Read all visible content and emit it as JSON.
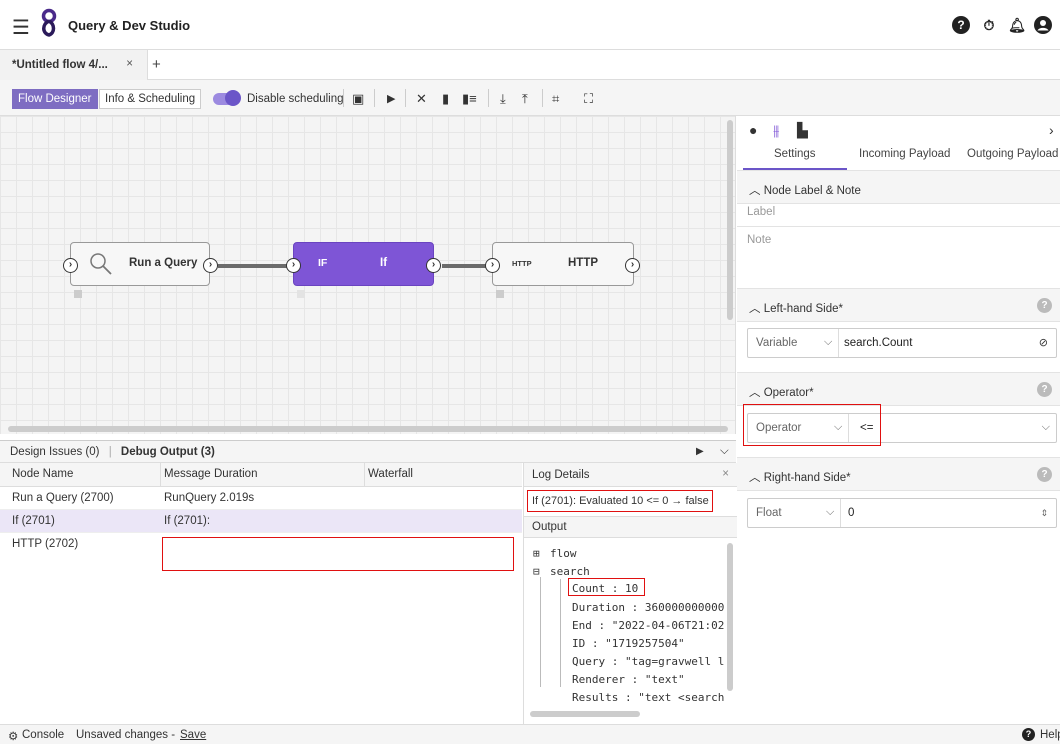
{
  "app": {
    "title": "Query & Dev Studio"
  },
  "tabs": [
    {
      "label": "*Untitled flow 4/...",
      "close": "×"
    }
  ],
  "tab_add": "+",
  "toolbar": {
    "flow_designer": "Flow Designer",
    "info_scheduling": "Info & Scheduling",
    "disable_scheduling": "Disable scheduling",
    "scheduling_disabled": true
  },
  "nodes": [
    {
      "label": "Run a Query",
      "icon": "magnifier-icon"
    },
    {
      "label": "If",
      "type": "IF"
    },
    {
      "label": "HTTP",
      "type": "HTTP"
    }
  ],
  "right_panel": {
    "tabs": [
      "Settings",
      "Incoming Payload",
      "Outgoing Payload"
    ],
    "node_label_section": "Node Label & Note",
    "label_placeholder": "Label",
    "note_placeholder": "Note",
    "lhs": {
      "title": "Left-hand Side*",
      "type": "Variable",
      "value": "search.Count"
    },
    "operator": {
      "title": "Operator*",
      "placeholder": "Operator",
      "value": "<="
    },
    "rhs": {
      "title": "Right-hand Side*",
      "type": "Float",
      "value": "0"
    }
  },
  "bottom": {
    "design_issues": "Design Issues (0)",
    "debug_output": "Debug Output (3)",
    "columns": [
      "Node Name",
      "Message",
      "Duration",
      "Waterfall"
    ],
    "rows": [
      {
        "name": "Run a Query (2700)",
        "message": "RunQuery 2.019s"
      },
      {
        "name": "If (2701)",
        "message": "If (2701):"
      },
      {
        "name": "HTTP (2702)",
        "message": ""
      }
    ],
    "log": {
      "title": "Log Details",
      "close": "×",
      "message": "If (2701): Evaluated 10 <= 0 → false",
      "output_label": "Output",
      "tree": {
        "flow": "flow",
        "search": "search",
        "children": [
          "Count : 10",
          "Duration : 360000000000",
          "End : \"2022-04-06T21:02",
          "ID : \"1719257504\"",
          "Query : \"tag=gravwell l",
          "Renderer : \"text\"",
          "Results : \"text <search"
        ]
      }
    }
  },
  "status": {
    "console": "Console",
    "unsaved": "Unsaved changes -",
    "save": "Save",
    "help": "Help"
  },
  "colors": {
    "accent": "#7e55d6",
    "highlight": "#e01010"
  }
}
